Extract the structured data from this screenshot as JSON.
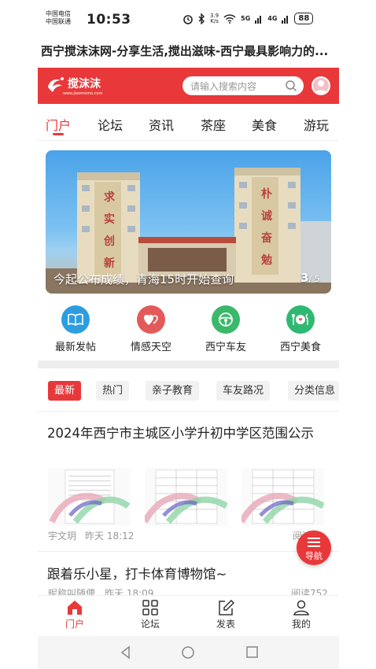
{
  "status_bar": {
    "carrier_1": "中国电信",
    "carrier_2": "中国联通",
    "time": "10:53",
    "speed_value": "3.9",
    "speed_unit": "K/s",
    "signal_1": "5G",
    "signal_2": "4G",
    "battery": "88"
  },
  "page_title": "西宁搅沫沫网-分享生活,搅出滋味-西宁最具影响力的...",
  "header": {
    "logo_text": "搅沫沫",
    "logo_sub": "www.jiaomomo.com",
    "search_placeholder": "请输入搜索内容",
    "accent_color": "#e8383a"
  },
  "tabs": [
    "门户",
    "论坛",
    "资讯",
    "茶座",
    "美食",
    "游玩"
  ],
  "banner": {
    "caption": "今起公布成绩，青海15时开始查询",
    "page_current": "3",
    "page_total": "/ 5",
    "left_tower": [
      "求",
      "实",
      "创",
      "新"
    ],
    "right_tower": [
      "朴",
      "诚",
      "奋",
      "勉"
    ]
  },
  "quick_links": [
    {
      "label": "最新发帖",
      "icon": "book-icon",
      "color": "#2d9de0"
    },
    {
      "label": "情感天空",
      "icon": "hearts-icon",
      "color": "#e35a5a"
    },
    {
      "label": "西宁车友",
      "icon": "steering-wheel-icon",
      "color": "#3bb86a"
    },
    {
      "label": "西宁美食",
      "icon": "dining-icon",
      "color": "#2fb871"
    }
  ],
  "filters": [
    "最新",
    "热门",
    "亲子教育",
    "车友路况",
    "分类信息"
  ],
  "articles": [
    {
      "title": "2024年西宁市主城区小学升初中学区范围公示",
      "author": "宇文玥",
      "time": "昨天 18:12",
      "reads": "阅读"
    },
    {
      "title": "跟着乐小星，打卡体育博物馆~",
      "author": "昵称叫随便",
      "time": "昨天 18:09",
      "reads": "阅读752"
    }
  ],
  "fab_label": "导航",
  "bottom_nav": [
    "门户",
    "论坛",
    "发表",
    "我的"
  ]
}
